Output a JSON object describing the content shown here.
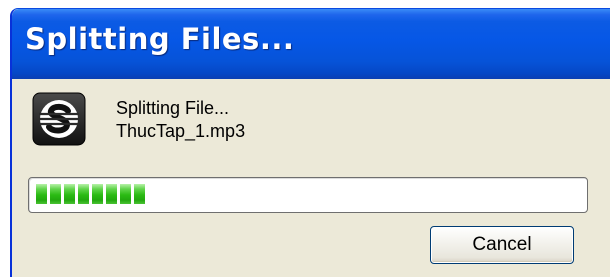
{
  "window": {
    "title": "Splitting Files..."
  },
  "status": {
    "line1": "Splitting File...",
    "filename": "ThucTap_1.mp3"
  },
  "progress": {
    "fraction": 0.15,
    "visible_segments": 8,
    "segment_color": "#2bbb14"
  },
  "buttons": {
    "cancel_label": "Cancel"
  },
  "icons": {
    "app_icon": "split-file-app-icon"
  },
  "colors": {
    "titlebar": "#0657e6",
    "dialog_background": "#ece9d8"
  }
}
